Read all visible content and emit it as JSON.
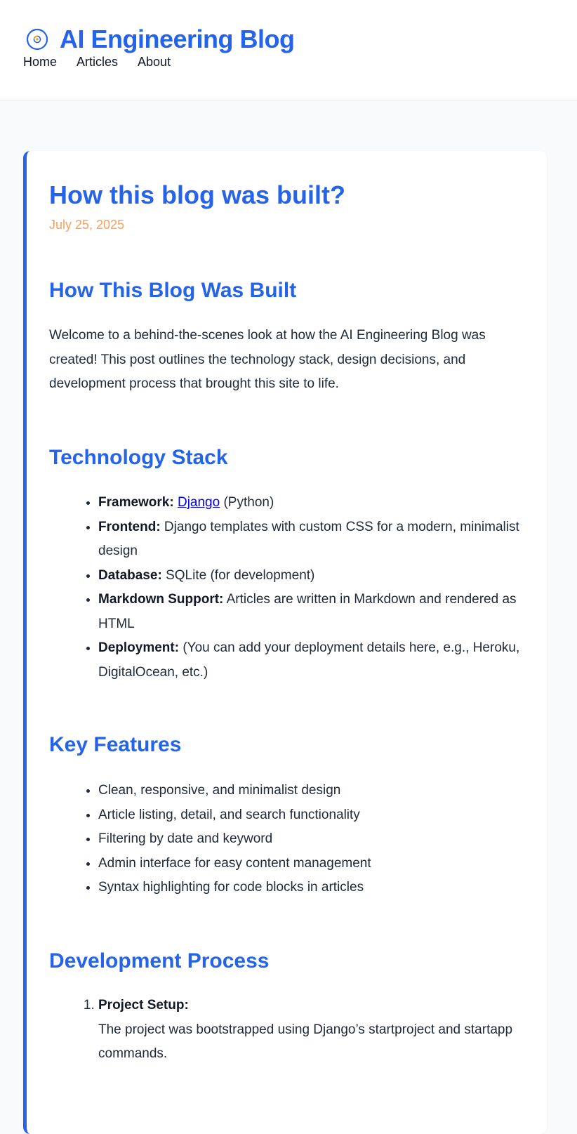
{
  "header": {
    "title": "AI Engineering Blog",
    "nav": [
      "Home",
      "Articles",
      "About"
    ],
    "logo_colors": {
      "ring": "#2563eb",
      "accent": "#f59e0b"
    }
  },
  "article": {
    "title": "How this blog was built?",
    "date": "July 25, 2025",
    "heading_main": "How This Blog Was Built",
    "intro": "Welcome to a behind-the-scenes look at how the AI Engineering Blog was created! This post outlines the technology stack, design decisions, and development process that brought this site to life.",
    "tech_stack": {
      "heading": "Technology Stack",
      "items": [
        {
          "label": "Framework:",
          "link": "Django",
          "text": " (Python)"
        },
        {
          "label": "Frontend:",
          "text": " Django templates with custom CSS for a modern, minimalist design"
        },
        {
          "label": "Database:",
          "text": " SQLite (for development)"
        },
        {
          "label": "Markdown Support:",
          "text": " Articles are written in Markdown and rendered as HTML"
        },
        {
          "label": "Deployment:",
          "text": " (You can add your deployment details here, e.g., Heroku, DigitalOcean, etc.)"
        }
      ]
    },
    "features": {
      "heading": "Key Features",
      "items": [
        "Clean, responsive, and minimalist design",
        "Article listing, detail, and search functionality",
        "Filtering by date and keyword",
        "Admin interface for easy content management",
        "Syntax highlighting for code blocks in articles"
      ]
    },
    "process": {
      "heading": "Development Process",
      "items": [
        {
          "label": "Project Setup:",
          "text": "The project was bootstrapped using Django’s startproject and startapp commands."
        }
      ]
    }
  },
  "colors": {
    "accent": "#2563eb",
    "date": "#f6a15b",
    "page_bg": "#f8fafc",
    "text": "#1f2937"
  }
}
